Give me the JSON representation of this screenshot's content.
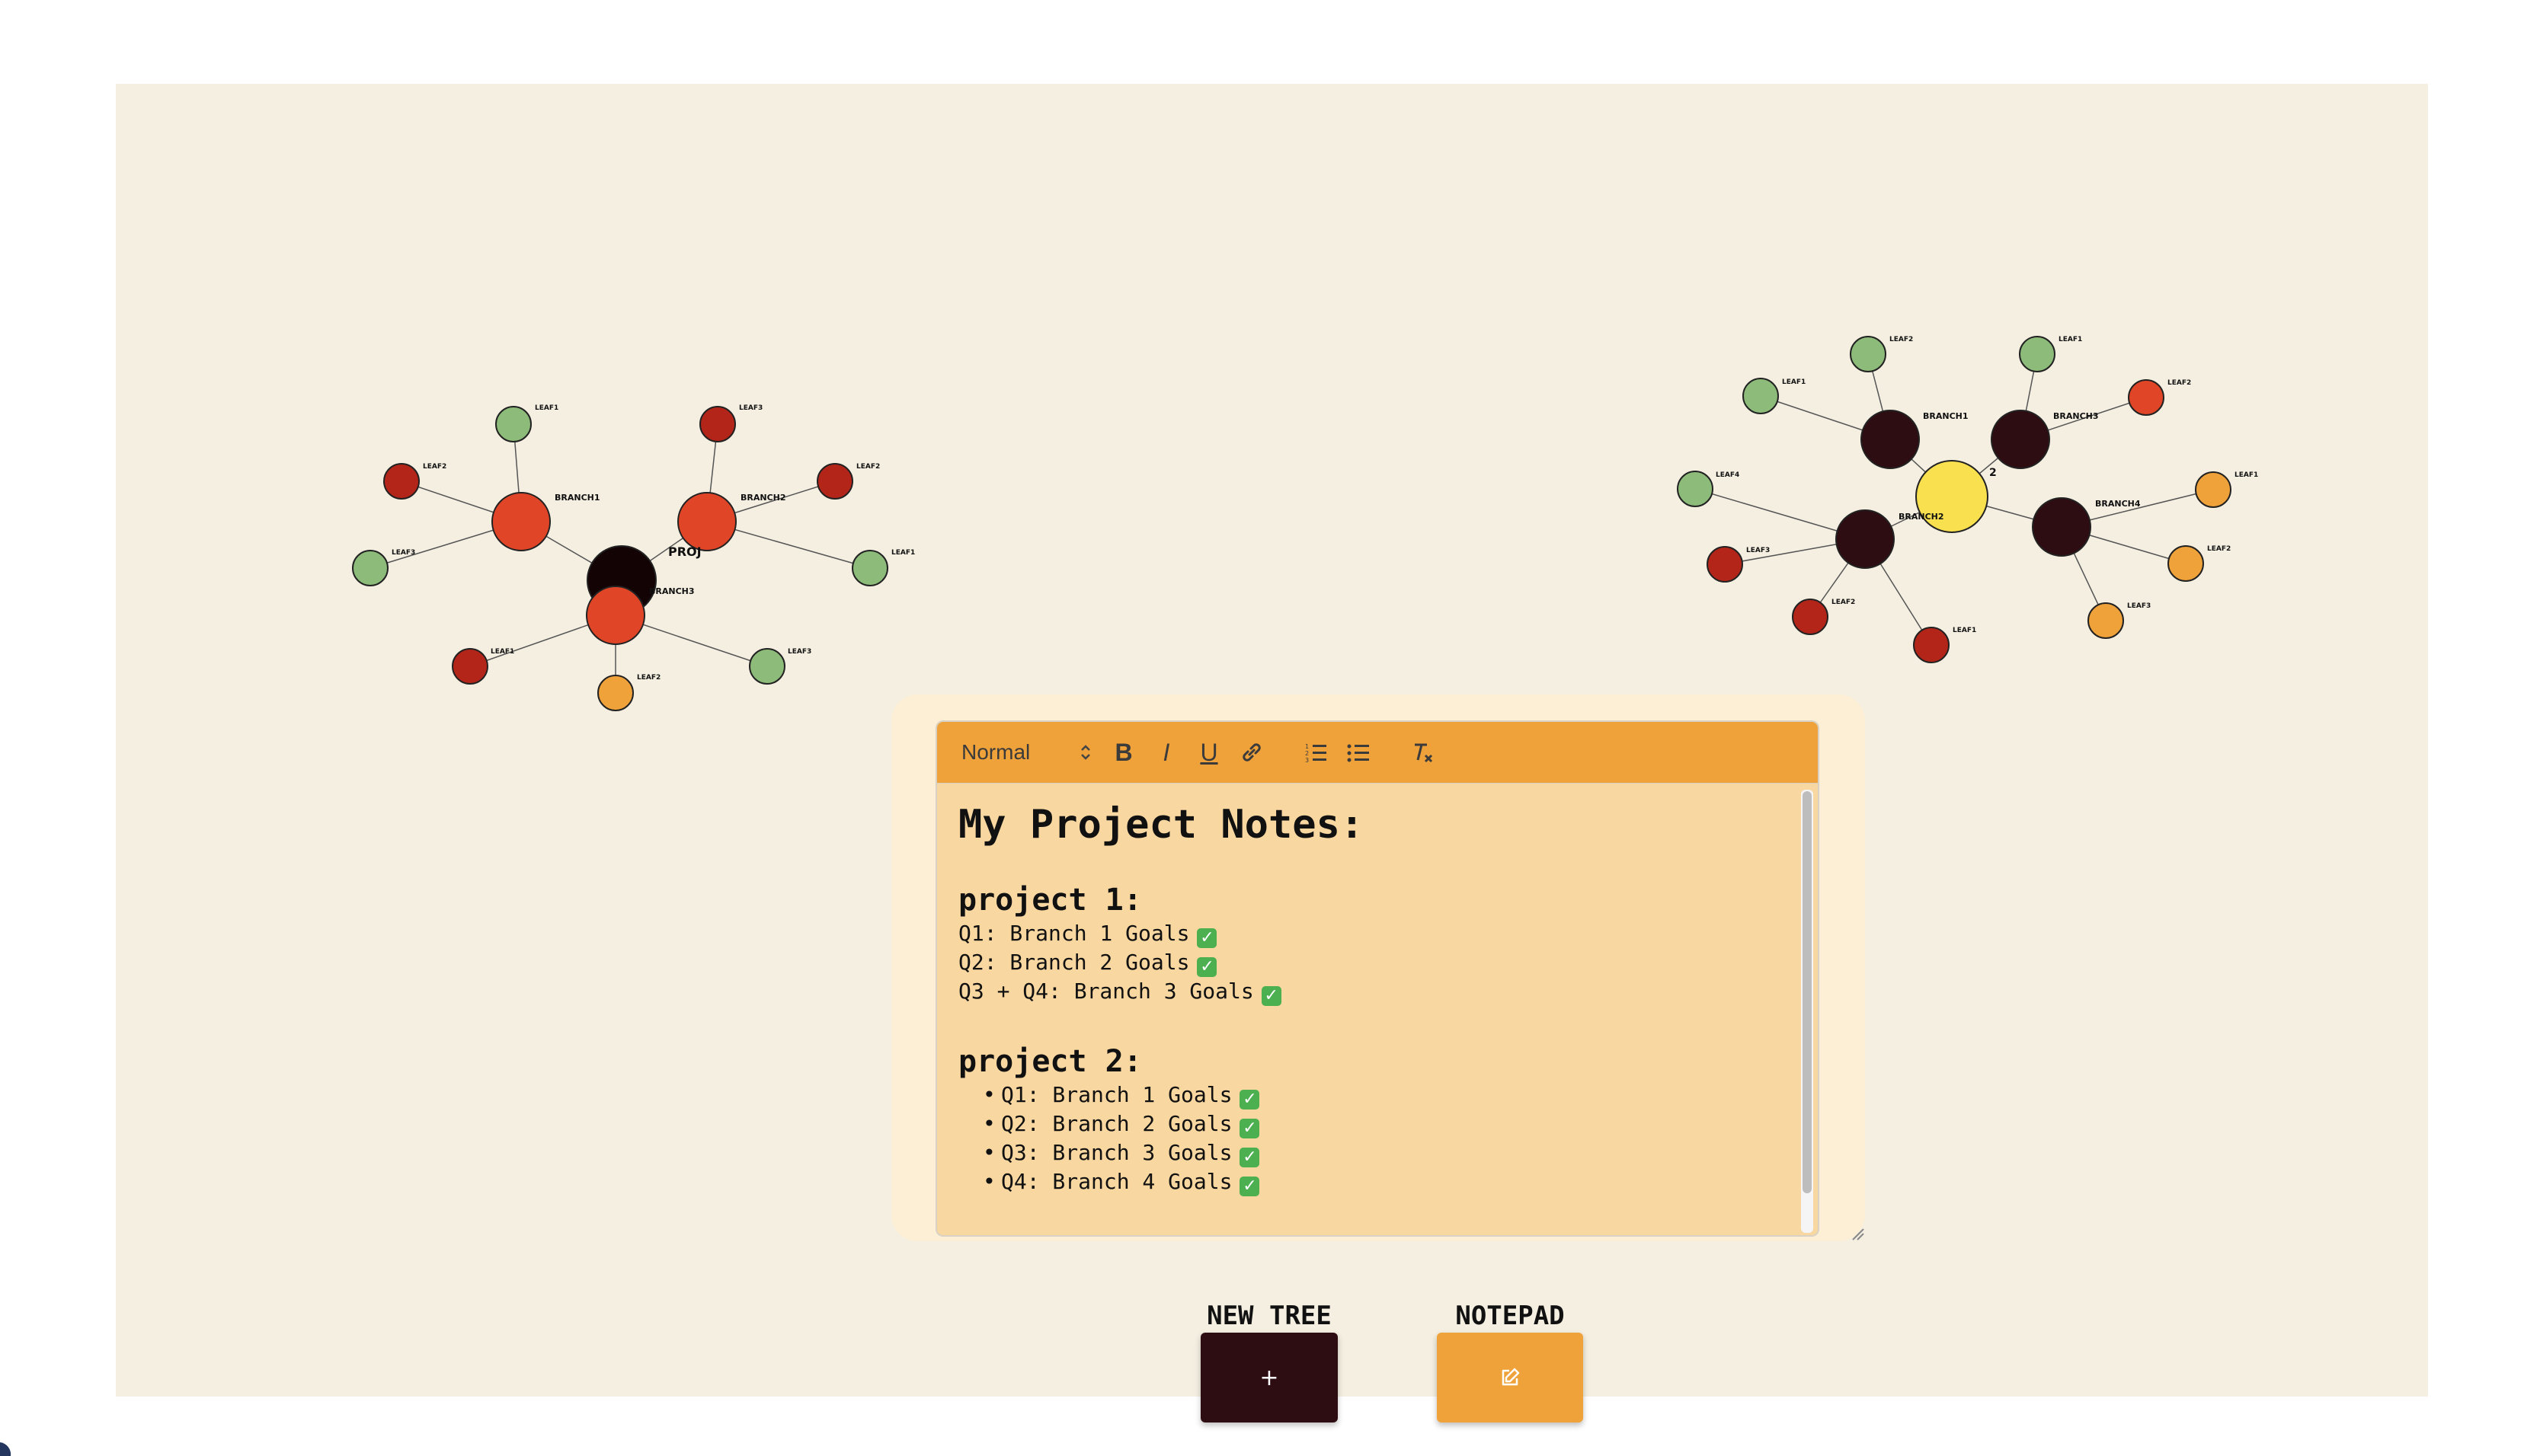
{
  "colors": {
    "canvas_bg": "#f4efe1",
    "toolbar": "#f0a23a",
    "editor_bg": "#f8d7a1",
    "panel_bg": "#fcefd5",
    "dark": "#2d0d12",
    "root_black": "#130305",
    "orange_red": "#df4526",
    "dark_red": "#b32519",
    "green": "#8dbb7a",
    "orange": "#f0a23a",
    "yellow": "#f9e04f"
  },
  "tree1": {
    "root": {
      "label": "PROJ",
      "color": "root_black"
    },
    "branches": [
      {
        "label": "BRANCH1",
        "color": "orange_red",
        "leaves": [
          {
            "label": "LEAF1",
            "color": "green"
          },
          {
            "label": "LEAF2",
            "color": "dark_red"
          },
          {
            "label": "LEAF3",
            "color": "green"
          }
        ]
      },
      {
        "label": "BRANCH2",
        "color": "orange_red",
        "leaves": [
          {
            "label": "LEAF3",
            "color": "dark_red"
          },
          {
            "label": "LEAF2",
            "color": "dark_red"
          },
          {
            "label": "LEAF1",
            "color": "green"
          }
        ]
      },
      {
        "label": "BRANCH3",
        "color": "orange_red",
        "leaves": [
          {
            "label": "LEAF1",
            "color": "dark_red"
          },
          {
            "label": "LEAF2",
            "color": "orange"
          },
          {
            "label": "LEAF3",
            "color": "green"
          }
        ]
      }
    ]
  },
  "tree2": {
    "root": {
      "label": "2",
      "color": "yellow"
    },
    "branches": [
      {
        "label": "BRANCH1",
        "color": "dark",
        "leaves": [
          {
            "label": "LEAF2",
            "color": "green"
          },
          {
            "label": "LEAF1",
            "color": "green"
          }
        ]
      },
      {
        "label": "BRANCH3",
        "color": "dark",
        "leaves": [
          {
            "label": "LEAF1",
            "color": "green"
          },
          {
            "label": "LEAF2",
            "color": "orange_red"
          }
        ]
      },
      {
        "label": "BRANCH2",
        "color": "dark",
        "leaves": [
          {
            "label": "LEAF4",
            "color": "green"
          },
          {
            "label": "LEAF3",
            "color": "dark_red"
          },
          {
            "label": "LEAF2",
            "color": "dark_red"
          },
          {
            "label": "LEAF1",
            "color": "dark_red"
          }
        ]
      },
      {
        "label": "BRANCH4",
        "color": "dark",
        "leaves": [
          {
            "label": "LEAF1",
            "color": "orange"
          },
          {
            "label": "LEAF2",
            "color": "orange"
          },
          {
            "label": "LEAF3",
            "color": "orange"
          }
        ]
      }
    ]
  },
  "toolbar": {
    "heading_select": "Normal",
    "bold": "B",
    "italic": "I",
    "underline": "U"
  },
  "notes": {
    "title": "My Project Notes:",
    "project1_heading": "project 1:",
    "project1_lines": [
      "Q1: Branch 1 Goals",
      "Q2: Branch 2 Goals",
      "Q3 + Q4: Branch 3 Goals"
    ],
    "project2_heading": "project 2:",
    "project2_items": [
      "Q1: Branch 1 Goals",
      "Q2: Branch 2 Goals",
      "Q3: Branch 3 Goals",
      "Q4: Branch 4 Goals"
    ],
    "check_mark": "✓",
    "bullet": "•"
  },
  "controls": {
    "new_tree_label": "NEW TREE",
    "new_tree_button": "+",
    "notepad_label": "NOTEPAD"
  }
}
